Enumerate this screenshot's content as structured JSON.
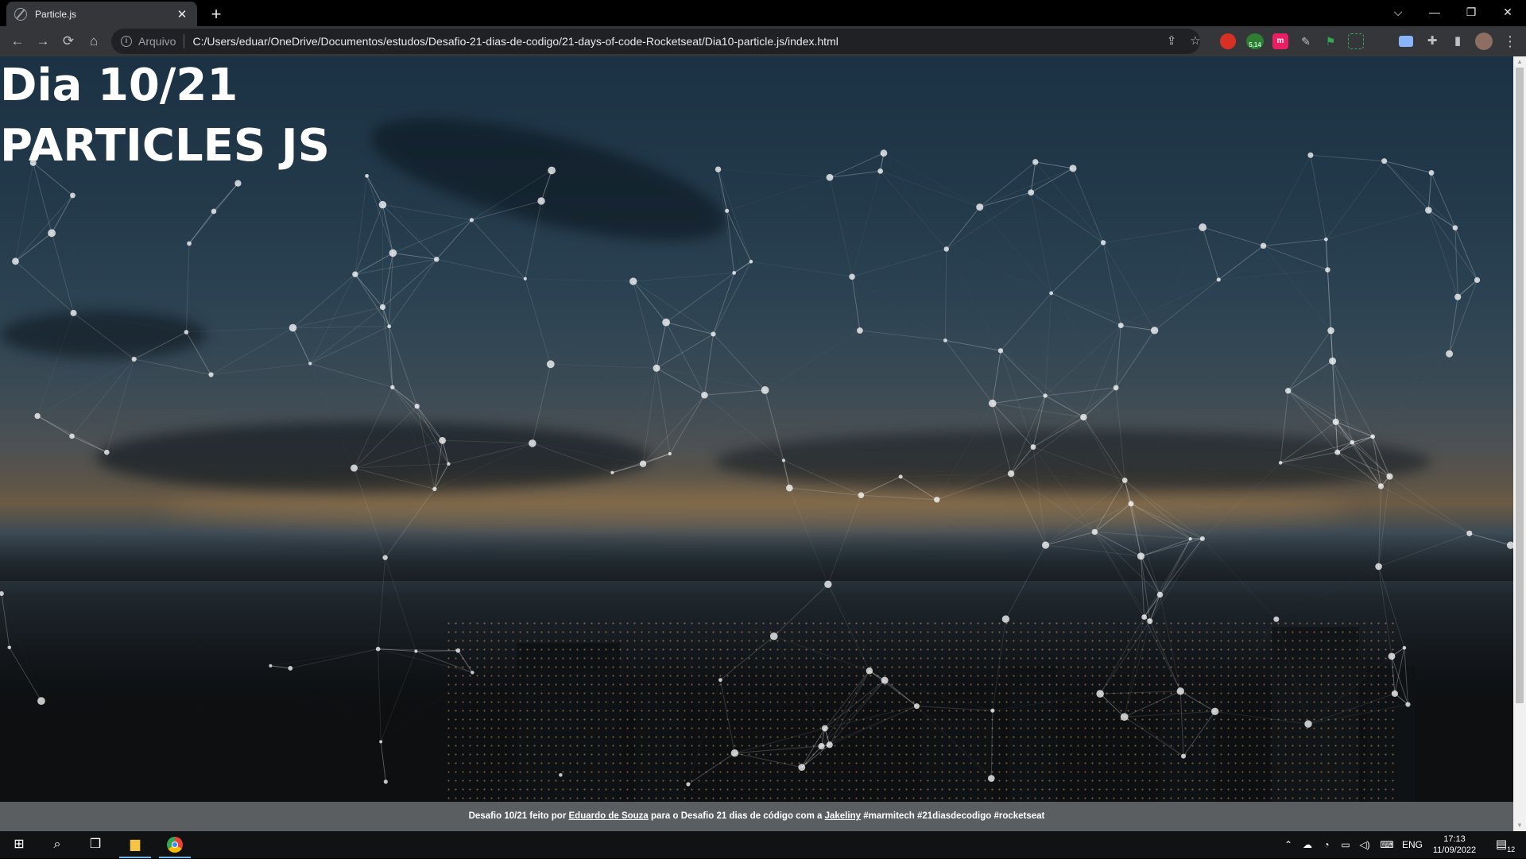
{
  "tab": {
    "title": "Particle.js",
    "close": "✕",
    "new_tab": "+"
  },
  "window_controls": {
    "dropdown": "⌵",
    "minimize": "—",
    "restore": "❐",
    "close": "✕"
  },
  "toolbar": {
    "back": "←",
    "forward": "→",
    "reload": "⟳",
    "home": "⌂",
    "site_label": "Arquivo",
    "url": "C:/Users/eduar/OneDrive/Documentos/estudos/Desafio-21-dias-de-codigo/21-days-of-code-Rocketseat/Dia10-particle.js/index.html",
    "extension_badge": "5,14"
  },
  "page": {
    "heading_day": "Dia 10/21",
    "heading_title": "PARTICLES JS",
    "footer": {
      "prefix": "Desafio 10/21 feito por ",
      "author": "Eduardo de Souza",
      "middle": " para o Desafio 21 dias de código com a ",
      "partner": "Jakeliny",
      "suffix": " #marmitech #21diasdecodigo #rocketseat"
    }
  },
  "taskbar": {
    "language": "ENG",
    "time": "17:13",
    "date": "11/09/2022",
    "notifications": "12"
  }
}
